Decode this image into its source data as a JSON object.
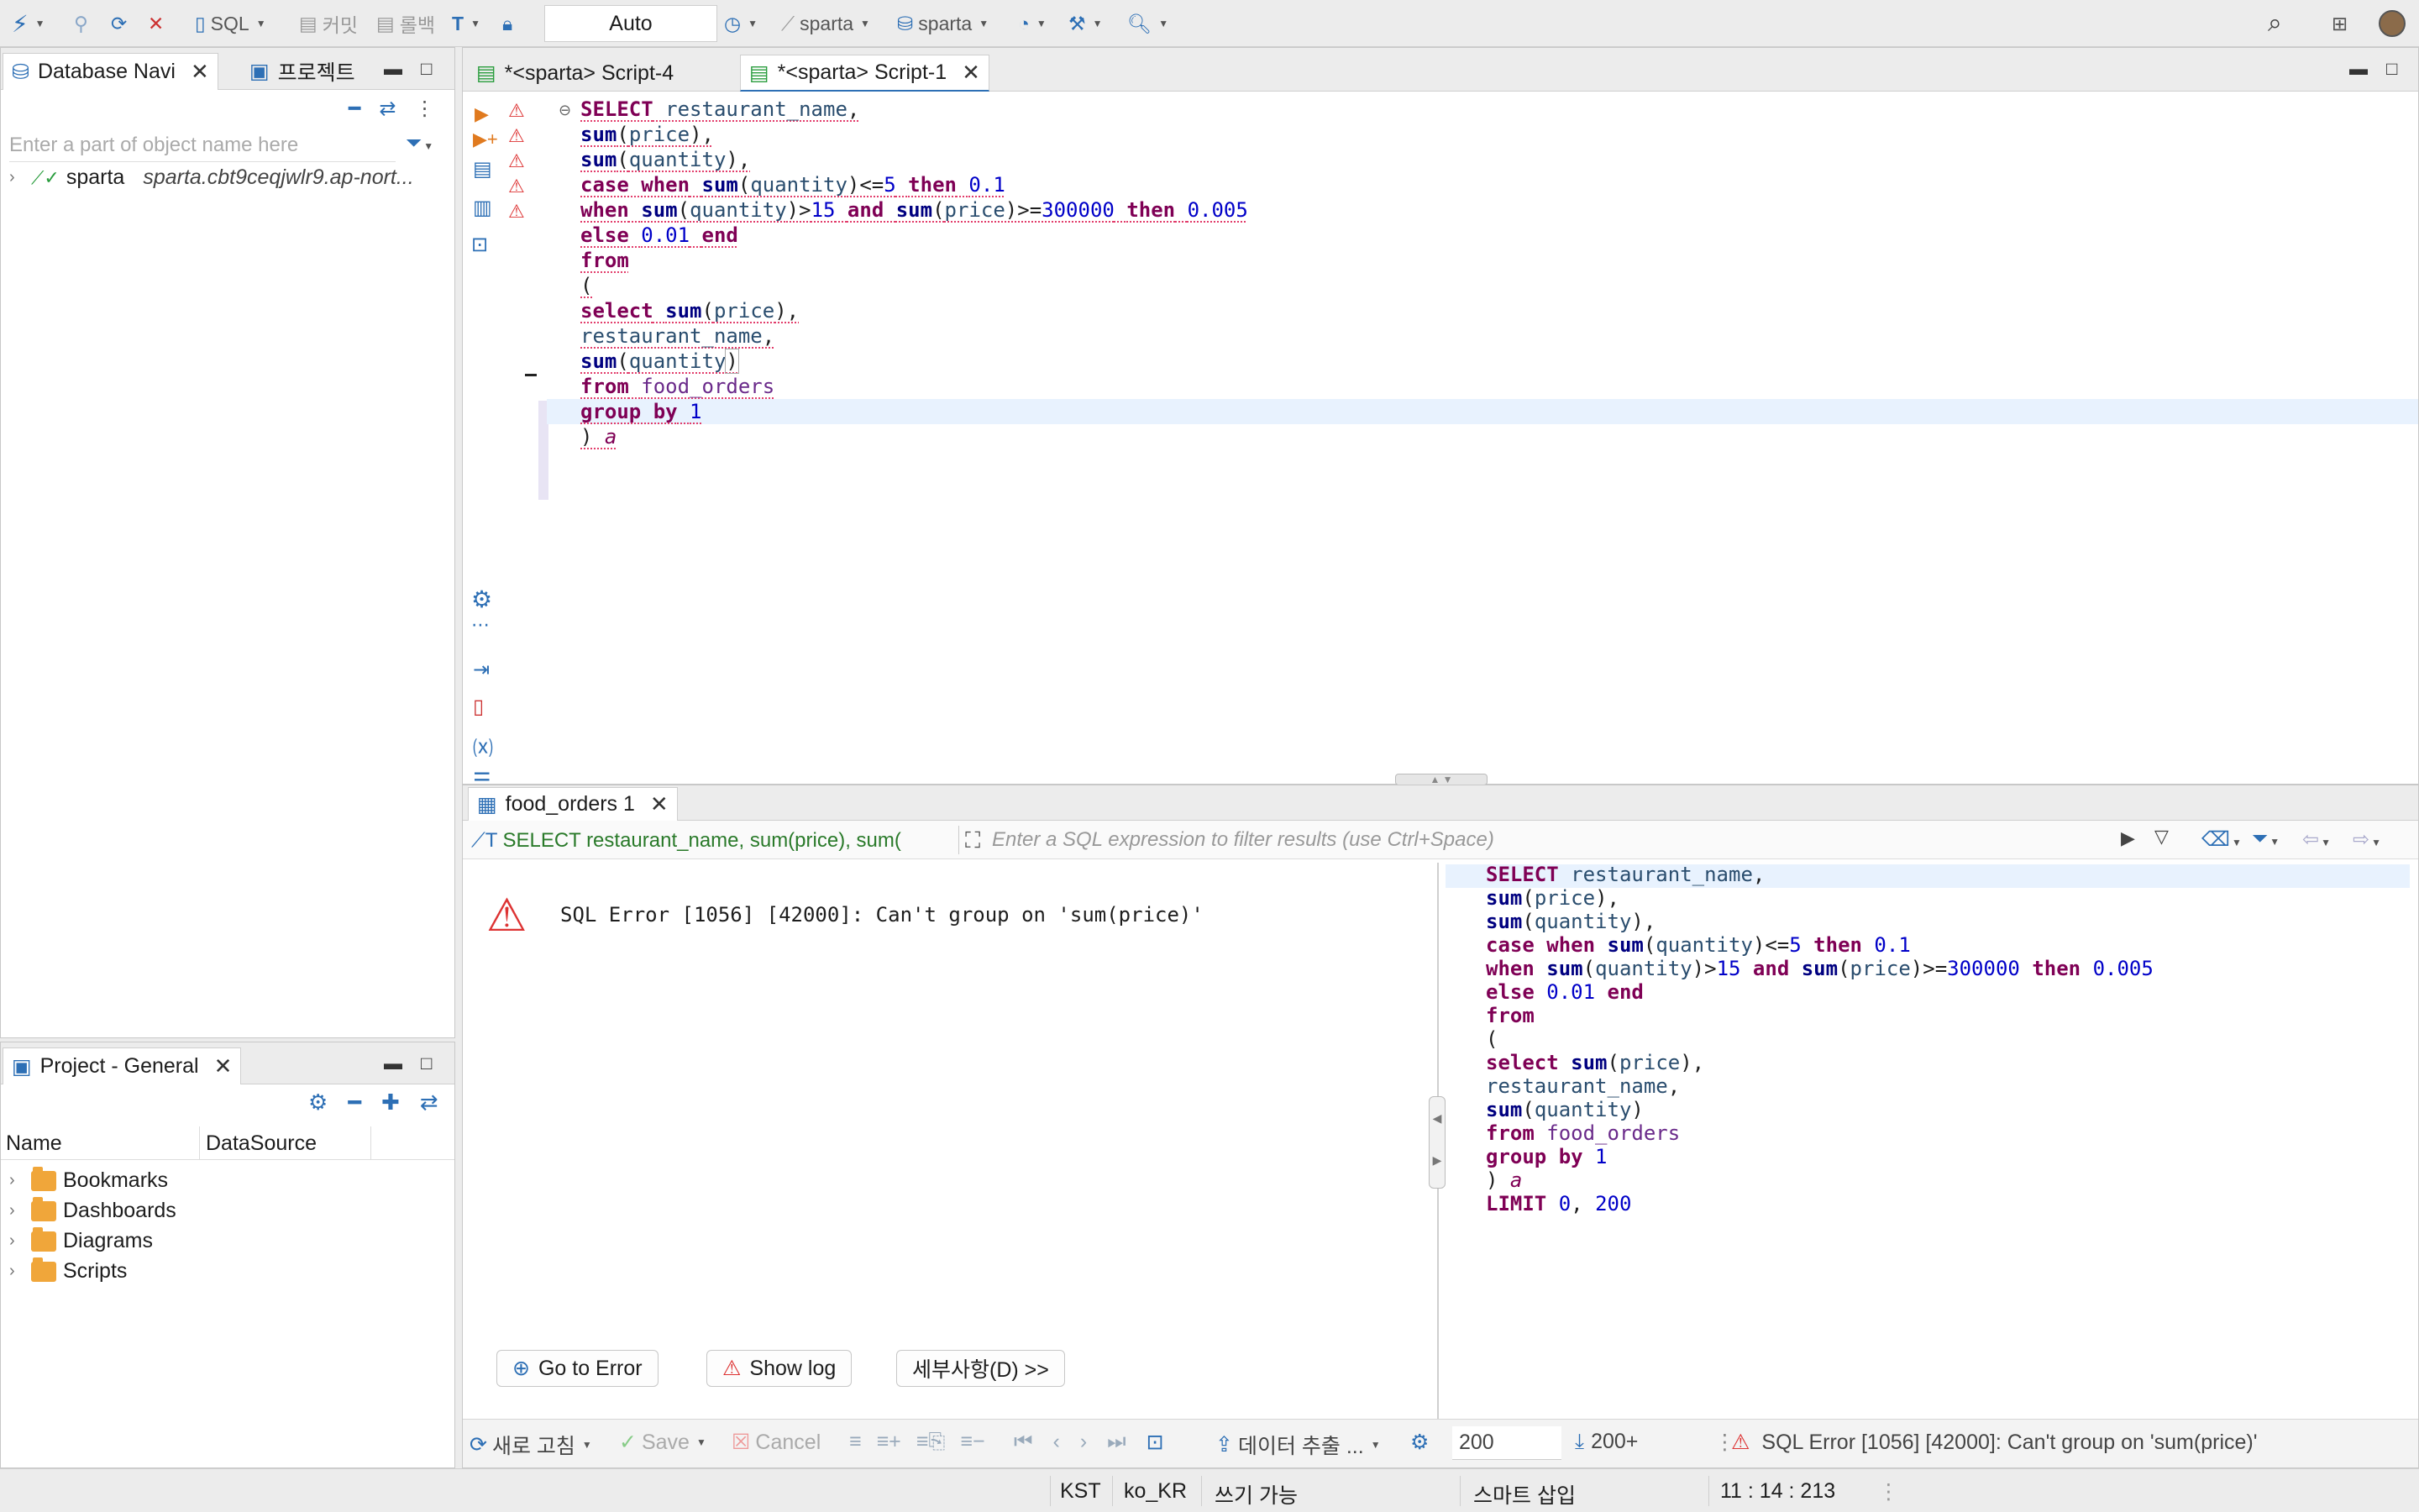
{
  "toolbar": {
    "sql_label": "SQL",
    "commit_label": "커밋",
    "rollback_label": "롤백",
    "transaction_mode": "Auto",
    "datasource_label": "sparta",
    "schema_label": "sparta"
  },
  "left_top": {
    "tab_db_nav": "Database Navi",
    "tab_project": "프로젝트",
    "filter_placeholder": "Enter a part of object name here",
    "connections": [
      {
        "name": "sparta",
        "host": "sparta.cbt9ceqjwlr9.ap-nort..."
      }
    ]
  },
  "left_bottom": {
    "tab_label": "Project - General",
    "col_name": "Name",
    "col_datasource": "DataSource",
    "items": [
      {
        "label": "Bookmarks"
      },
      {
        "label": "Dashboards"
      },
      {
        "label": "Diagrams"
      },
      {
        "label": "Scripts"
      }
    ]
  },
  "editor": {
    "tabs": [
      {
        "label": "*<sparta> Script-4",
        "active": false
      },
      {
        "label": "*<sparta> Script-1",
        "active": true
      }
    ]
  },
  "results": {
    "tab_label": "food_orders 1",
    "query_preview": "SELECT restaurant_name, sum(price), sum(",
    "filter_placeholder": "Enter a SQL expression to filter results (use Ctrl+Space)",
    "error_message": "SQL Error [1056] [42000]: Can't group on 'sum(price)'",
    "go_to_error": "Go to Error",
    "show_log": "Show log",
    "details": "세부사항(D) >>",
    "refresh_label": "새로 고침",
    "save_label": "Save",
    "cancel_label": "Cancel",
    "export_label": "데이터 추출 ...",
    "fetch_size": "200",
    "row_count": "200+",
    "status_error": "SQL Error [1056] [42000]: Can't group on 'sum(price)'"
  },
  "statusbar": {
    "timezone": "KST",
    "locale": "ko_KR",
    "mode": "쓰기 가능",
    "insert": "스마트 삽입",
    "cursor": "11 : 14 : 213"
  }
}
